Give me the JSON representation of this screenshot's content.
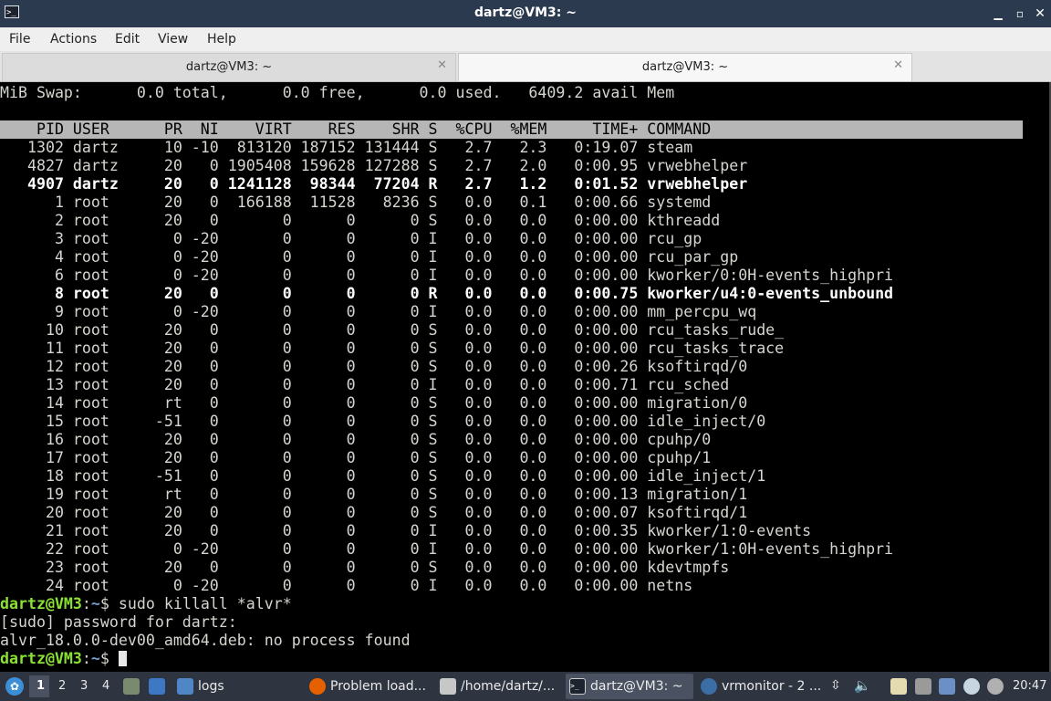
{
  "window": {
    "title": "dartz@VM3: ~",
    "icon": "terminal-icon",
    "controls": [
      "minimize-icon",
      "maximize-icon",
      "close-icon"
    ]
  },
  "menu": [
    "File",
    "Actions",
    "Edit",
    "View",
    "Help"
  ],
  "tabs": [
    {
      "label": "dartz@VM3: ~",
      "active": false
    },
    {
      "label": "dartz@VM3: ~",
      "active": true
    }
  ],
  "terminal": {
    "swap_line": "MiB Swap:      0.0 total,      0.0 free,      0.0 used.   6409.2 avail Mem",
    "table_header": "    PID USER      PR  NI    VIRT    RES    SHR S  %CPU  %MEM     TIME+ COMMAND",
    "processes": [
      {
        "text": "   1302 dartz     10 -10  813120 187152 131444 S   2.7   2.3   0:19.07 steam",
        "bold": false
      },
      {
        "text": "   4827 dartz     20   0 1905408 159628 127288 S   2.7   2.0   0:00.95 vrwebhelper",
        "bold": false
      },
      {
        "text": "   4907 dartz     20   0 1241128  98344  77204 R   2.7   1.2   0:01.52 vrwebhelper",
        "bold": true
      },
      {
        "text": "      1 root      20   0  166188  11528   8236 S   0.0   0.1   0:00.66 systemd",
        "bold": false
      },
      {
        "text": "      2 root      20   0       0      0      0 S   0.0   0.0   0:00.00 kthreadd",
        "bold": false
      },
      {
        "text": "      3 root       0 -20       0      0      0 I   0.0   0.0   0:00.00 rcu_gp",
        "bold": false
      },
      {
        "text": "      4 root       0 -20       0      0      0 I   0.0   0.0   0:00.00 rcu_par_gp",
        "bold": false
      },
      {
        "text": "      6 root       0 -20       0      0      0 I   0.0   0.0   0:00.00 kworker/0:0H-events_highpri",
        "bold": false
      },
      {
        "text": "      8 root      20   0       0      0      0 R   0.0   0.0   0:00.75 kworker/u4:0-events_unbound",
        "bold": true
      },
      {
        "text": "      9 root       0 -20       0      0      0 I   0.0   0.0   0:00.00 mm_percpu_wq",
        "bold": false
      },
      {
        "text": "     10 root      20   0       0      0      0 S   0.0   0.0   0:00.00 rcu_tasks_rude_",
        "bold": false
      },
      {
        "text": "     11 root      20   0       0      0      0 S   0.0   0.0   0:00.00 rcu_tasks_trace",
        "bold": false
      },
      {
        "text": "     12 root      20   0       0      0      0 S   0.0   0.0   0:00.26 ksoftirqd/0",
        "bold": false
      },
      {
        "text": "     13 root      20   0       0      0      0 I   0.0   0.0   0:00.71 rcu_sched",
        "bold": false
      },
      {
        "text": "     14 root      rt   0       0      0      0 S   0.0   0.0   0:00.00 migration/0",
        "bold": false
      },
      {
        "text": "     15 root     -51   0       0      0      0 S   0.0   0.0   0:00.00 idle_inject/0",
        "bold": false
      },
      {
        "text": "     16 root      20   0       0      0      0 S   0.0   0.0   0:00.00 cpuhp/0",
        "bold": false
      },
      {
        "text": "     17 root      20   0       0      0      0 S   0.0   0.0   0:00.00 cpuhp/1",
        "bold": false
      },
      {
        "text": "     18 root     -51   0       0      0      0 S   0.0   0.0   0:00.00 idle_inject/1",
        "bold": false
      },
      {
        "text": "     19 root      rt   0       0      0      0 S   0.0   0.0   0:00.13 migration/1",
        "bold": false
      },
      {
        "text": "     20 root      20   0       0      0      0 S   0.0   0.0   0:00.07 ksoftirqd/1",
        "bold": false
      },
      {
        "text": "     21 root      20   0       0      0      0 I   0.0   0.0   0:00.35 kworker/1:0-events",
        "bold": false
      },
      {
        "text": "     22 root       0 -20       0      0      0 I   0.0   0.0   0:00.00 kworker/1:0H-events_highpri",
        "bold": false
      },
      {
        "text": "     23 root      20   0       0      0      0 S   0.0   0.0   0:00.00 kdevtmpfs",
        "bold": false
      },
      {
        "text": "     24 root       0 -20       0      0      0 I   0.0   0.0   0:00.00 netns",
        "bold": false
      }
    ],
    "prompt_user": "dartz@VM3",
    "prompt_sep": ":",
    "prompt_path": "~",
    "prompt_sign": "$ ",
    "command1": "sudo killall *alvr*",
    "output1": "[sudo] password for dartz:",
    "output2": "alvr_18.0.0-dev00_amd64.deb: no process found",
    "colors": {
      "prompt_user": "#8ae234",
      "prompt_path": "#729fcf",
      "header_bg": "#b6b6b6"
    }
  },
  "taskbar": {
    "workspaces": [
      "1",
      "2",
      "3",
      "4"
    ],
    "active_workspace": "1",
    "launchers": [
      "start-menu-icon",
      "file-manager-icon",
      "show-desktop-icon"
    ],
    "folder_label": "logs",
    "tasks": [
      {
        "label": "Problem load...",
        "icon": "firefox-icon"
      },
      {
        "label": "/home/dartz/...",
        "icon": "text-editor-icon"
      },
      {
        "label": "dartz@VM3: ~",
        "icon": "terminal-icon",
        "active": true
      },
      {
        "label": "vrmonitor - 2 ...",
        "icon": "steamvr-icon"
      }
    ],
    "tray": [
      "scroll-icon",
      "volume-icon",
      "clipboard-icon",
      "network-icon",
      "bluetooth-icon",
      "steam-icon",
      "power-icon"
    ],
    "clock": "20:47"
  }
}
